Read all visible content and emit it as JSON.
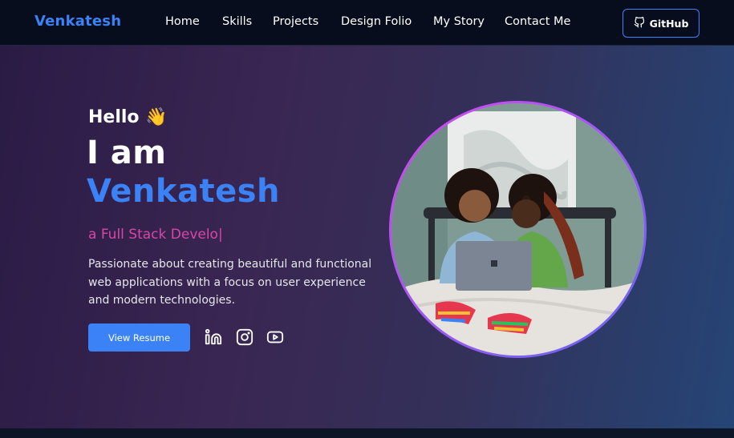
{
  "nav": {
    "brand": "Venkatesh",
    "links": [
      {
        "label": "Home"
      },
      {
        "label": "Skills"
      },
      {
        "label": "Projects"
      },
      {
        "label": "Design Folio"
      },
      {
        "label": "My Story"
      },
      {
        "label": "Contact Me"
      }
    ],
    "github_label": "GitHub"
  },
  "hero": {
    "greeting": "Hello",
    "greeting_emoji": "👋",
    "intro": "I am",
    "name": "Venkatesh",
    "typed_role": "a Full Stack Develo|",
    "description": "Passionate about creating beautiful and functional web applications with a focus on user experience and modern technologies.",
    "resume_label": "View Resume",
    "socials": [
      "linkedin-icon",
      "instagram-icon",
      "youtube-icon"
    ],
    "portrait_alt": "Two people on a bed looking at a laptop"
  },
  "colors": {
    "accent": "#3b82f6",
    "role": "#d946a8",
    "nav_bg": "#070d1c"
  }
}
